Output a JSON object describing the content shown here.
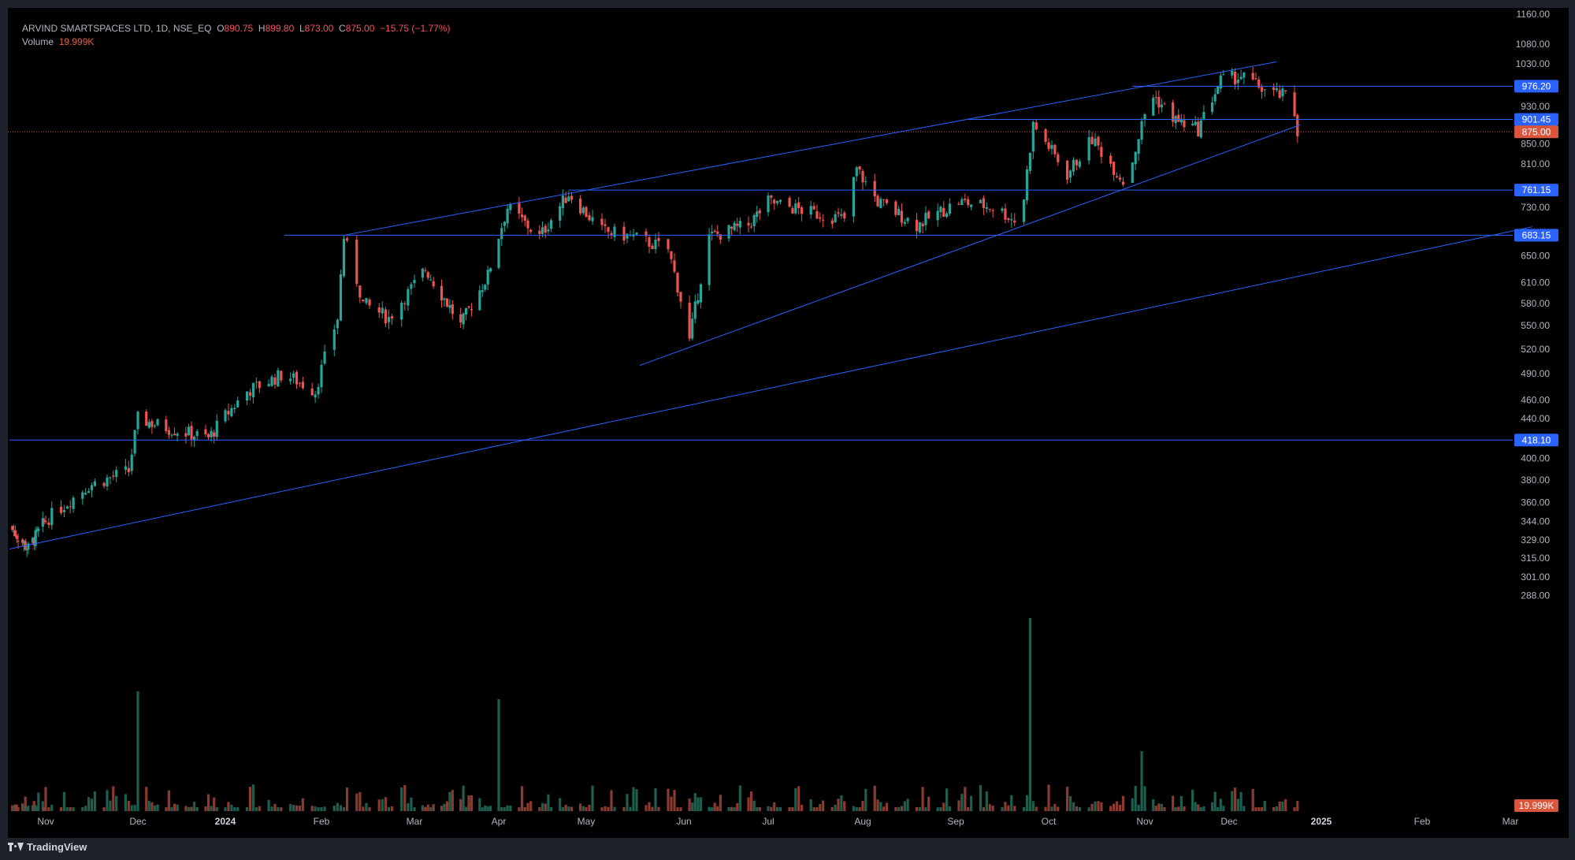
{
  "header": {
    "symbol": "ARVIND SMARTSPACES LTD, 1D, NSE_EQ",
    "open_label": "O",
    "open": "890.75",
    "high_label": "H",
    "high": "899.80",
    "low_label": "L",
    "low": "873.00",
    "close_label": "C",
    "close": "875.00",
    "change": "−15.75 (−1.77%)",
    "volume_label": "Volume",
    "volume": "19.999K"
  },
  "branding": {
    "name": "TradingView"
  },
  "colors": {
    "up": "#26a69a",
    "down": "#ef5350",
    "up_vol": "#1e5e4f",
    "down_vol": "#8a3a2e",
    "line": "#2962ff",
    "label_bg": "#2962ff",
    "price_label_bg": "#d9553c",
    "background": "#000000",
    "frame": "#1e222d",
    "axis_text": "#b2b5be"
  },
  "chart_data": {
    "type": "candlestick",
    "title": "ARVIND SMARTSPACES LTD, 1D, NSE_EQ",
    "scale": "log",
    "ylim": [
      300,
      1160
    ],
    "y_ticks": [
      1160,
      1080,
      1030,
      930,
      850,
      810,
      730,
      650,
      610,
      580,
      550,
      520,
      490,
      460,
      440,
      400,
      380,
      360,
      344,
      329,
      315,
      301,
      288
    ],
    "x_ticks": [
      "Nov",
      "Dec",
      "2024",
      "Feb",
      "Mar",
      "Apr",
      "May",
      "Jun",
      "Jul",
      "Aug",
      "Sep",
      "Oct",
      "Nov",
      "Dec",
      "2025",
      "Feb",
      "Mar"
    ],
    "x_tick_dates": [
      "2023-11-01",
      "2023-12-01",
      "2024-01-01",
      "2024-02-01",
      "2024-03-01",
      "2024-04-01",
      "2024-05-01",
      "2024-06-01",
      "2024-07-01",
      "2024-08-01",
      "2024-09-01",
      "2024-10-01",
      "2024-11-01",
      "2024-12-01",
      "2025-01-01",
      "2025-02-01",
      "2025-03-01"
    ],
    "last_price": 875.0,
    "volume_last": "19.999K",
    "horizontal_levels": [
      {
        "price": 976.2,
        "label": "976.20",
        "start_date": "2024-10-28"
      },
      {
        "price": 901.45,
        "label": "901.45",
        "start_date": "2024-09-05"
      },
      {
        "price": 761.15,
        "label": "761.15",
        "start_date": "2024-04-25"
      },
      {
        "price": 683.15,
        "label": "683.15",
        "start_date": "2024-01-20"
      },
      {
        "price": 418.1,
        "label": "418.10",
        "start_date": "2023-10-07"
      }
    ],
    "trend_lines": [
      {
        "from": {
          "date": "2024-02-08",
          "price": 683
        },
        "to": {
          "date": "2024-12-17",
          "price": 1035
        }
      },
      {
        "from": {
          "date": "2024-05-18",
          "price": 500
        },
        "to": {
          "date": "2024-12-25",
          "price": 890
        }
      },
      {
        "from": {
          "date": "2023-10-07",
          "price": 322
        },
        "to": {
          "date": "2025-03-08",
          "price": 697
        }
      }
    ],
    "price_anchors": [
      [
        "2023-10-07",
        340
      ],
      [
        "2023-10-20",
        322
      ],
      [
        "2023-11-01",
        345
      ],
      [
        "2023-11-15",
        375
      ],
      [
        "2023-11-28",
        388
      ],
      [
        "2023-12-01",
        440
      ],
      [
        "2023-12-12",
        430
      ],
      [
        "2023-12-26",
        420
      ],
      [
        "2024-01-08",
        470
      ],
      [
        "2024-01-20",
        490
      ],
      [
        "2024-01-30",
        470
      ],
      [
        "2024-02-06",
        560
      ],
      [
        "2024-02-08",
        680
      ],
      [
        "2024-02-14",
        580
      ],
      [
        "2024-02-22",
        560
      ],
      [
        "2024-03-05",
        630
      ],
      [
        "2024-03-18",
        550
      ],
      [
        "2024-03-28",
        620
      ],
      [
        "2024-04-04",
        730
      ],
      [
        "2024-04-15",
        680
      ],
      [
        "2024-04-25",
        755
      ],
      [
        "2024-05-06",
        690
      ],
      [
        "2024-05-16",
        680
      ],
      [
        "2024-05-27",
        660
      ],
      [
        "2024-06-03",
        530
      ],
      [
        "2024-06-10",
        680
      ],
      [
        "2024-06-24",
        700
      ],
      [
        "2024-07-01",
        740
      ],
      [
        "2024-07-16",
        720
      ],
      [
        "2024-07-26",
        710
      ],
      [
        "2024-07-30",
        800
      ],
      [
        "2024-08-06",
        740
      ],
      [
        "2024-08-19",
        700
      ],
      [
        "2024-09-02",
        740
      ],
      [
        "2024-09-14",
        730
      ],
      [
        "2024-09-22",
        700
      ],
      [
        "2024-09-26",
        890
      ],
      [
        "2024-10-07",
        790
      ],
      [
        "2024-10-15",
        860
      ],
      [
        "2024-10-26",
        770
      ],
      [
        "2024-11-03",
        960
      ],
      [
        "2024-11-12",
        900
      ],
      [
        "2024-11-20",
        880
      ],
      [
        "2024-11-28",
        990
      ],
      [
        "2024-12-05",
        1000
      ],
      [
        "2024-12-15",
        960
      ],
      [
        "2024-12-22",
        950
      ],
      [
        "2024-12-24",
        875
      ]
    ],
    "volume_spikes": [
      {
        "date": "2023-12-01",
        "volume_rel": 0.62
      },
      {
        "date": "2024-03-31",
        "volume_rel": 0.58
      },
      {
        "date": "2024-09-25",
        "volume_rel": 1.0
      },
      {
        "date": "2024-10-31",
        "volume_rel": 0.31
      }
    ]
  }
}
